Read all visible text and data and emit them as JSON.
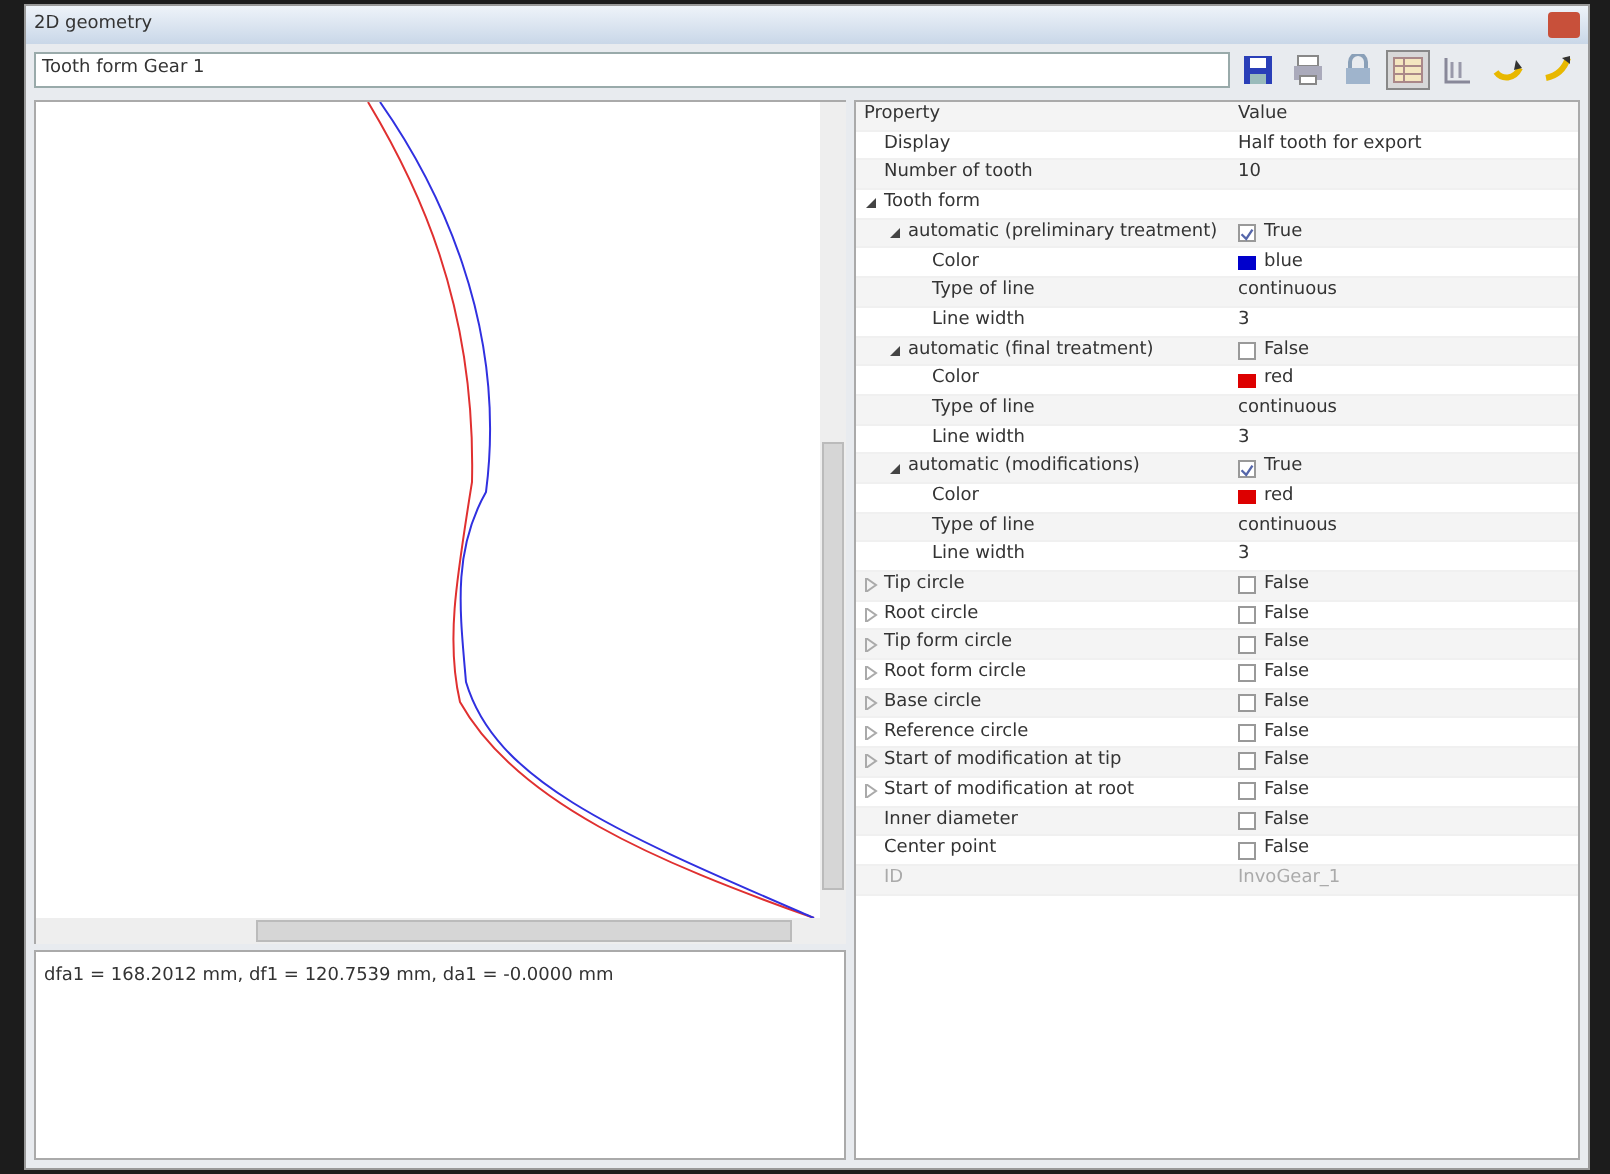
{
  "window": {
    "title": "2D geometry"
  },
  "toolbar": {
    "combo_value": "Tooth form Gear 1",
    "buttons": [
      {
        "selected": false
      },
      {
        "selected": false
      },
      {
        "selected": false
      },
      {
        "selected": true
      },
      {
        "selected": false
      },
      {
        "selected": false
      },
      {
        "selected": false
      }
    ]
  },
  "readout": "dfa1 = 168.2012 mm, df1 = 120.7539 mm, da1 = -0.0000 mm",
  "grid": {
    "columns": [
      "Property",
      "Value"
    ],
    "rows": [
      {
        "name": "Display",
        "kind": "text",
        "value": "Half tooth for export"
      },
      {
        "name": "Number of tooth",
        "kind": "text",
        "value": "10"
      },
      {
        "name": "Tooth form",
        "kind": "group",
        "expanded": true,
        "children": [
          {
            "name": "automatic (preliminary treatment)",
            "kind": "check",
            "checked": true,
            "value": "True",
            "expanded": true,
            "children": [
              {
                "name": "Color",
                "kind": "color",
                "color": "#0000cc",
                "value": "blue"
              },
              {
                "name": "Type of line",
                "kind": "text",
                "value": "continuous"
              },
              {
                "name": "Line width",
                "kind": "text",
                "value": "3"
              }
            ]
          },
          {
            "name": "automatic (final treatment)",
            "kind": "check",
            "checked": false,
            "value": "False",
            "expanded": true,
            "children": [
              {
                "name": "Color",
                "kind": "color",
                "color": "#dd0000",
                "value": "red"
              },
              {
                "name": "Type of line",
                "kind": "text",
                "value": "continuous"
              },
              {
                "name": "Line width",
                "kind": "text",
                "value": "3"
              }
            ]
          },
          {
            "name": "automatic (modifications)",
            "kind": "check",
            "checked": true,
            "value": "True",
            "expanded": true,
            "children": [
              {
                "name": "Color",
                "kind": "color",
                "color": "#dd0000",
                "value": "red"
              },
              {
                "name": "Type of line",
                "kind": "text",
                "value": "continuous"
              },
              {
                "name": "Line width",
                "kind": "text",
                "value": "3"
              }
            ]
          }
        ]
      },
      {
        "name": "Tip circle",
        "kind": "check",
        "checked": false,
        "value": "False",
        "expanded": false
      },
      {
        "name": "Root circle",
        "kind": "check",
        "checked": false,
        "value": "False",
        "expanded": false
      },
      {
        "name": "Tip form circle",
        "kind": "check",
        "checked": false,
        "value": "False",
        "expanded": false
      },
      {
        "name": "Root form circle",
        "kind": "check",
        "checked": false,
        "value": "False",
        "expanded": false
      },
      {
        "name": "Base circle",
        "kind": "check",
        "checked": false,
        "value": "False",
        "expanded": false
      },
      {
        "name": "Reference circle",
        "kind": "check",
        "checked": false,
        "value": "False",
        "expanded": false
      },
      {
        "name": "Start of modification at tip",
        "kind": "check",
        "checked": false,
        "value": "False",
        "expanded": false
      },
      {
        "name": "Start of modification at root",
        "kind": "check",
        "checked": false,
        "value": "False",
        "expanded": false
      },
      {
        "name": "Inner diameter",
        "kind": "check",
        "checked": false,
        "value": "False"
      },
      {
        "name": "Center point",
        "kind": "check",
        "checked": false,
        "value": "False"
      },
      {
        "name": "ID",
        "kind": "text",
        "value": "InvoGear_1",
        "disabled": true
      }
    ]
  }
}
